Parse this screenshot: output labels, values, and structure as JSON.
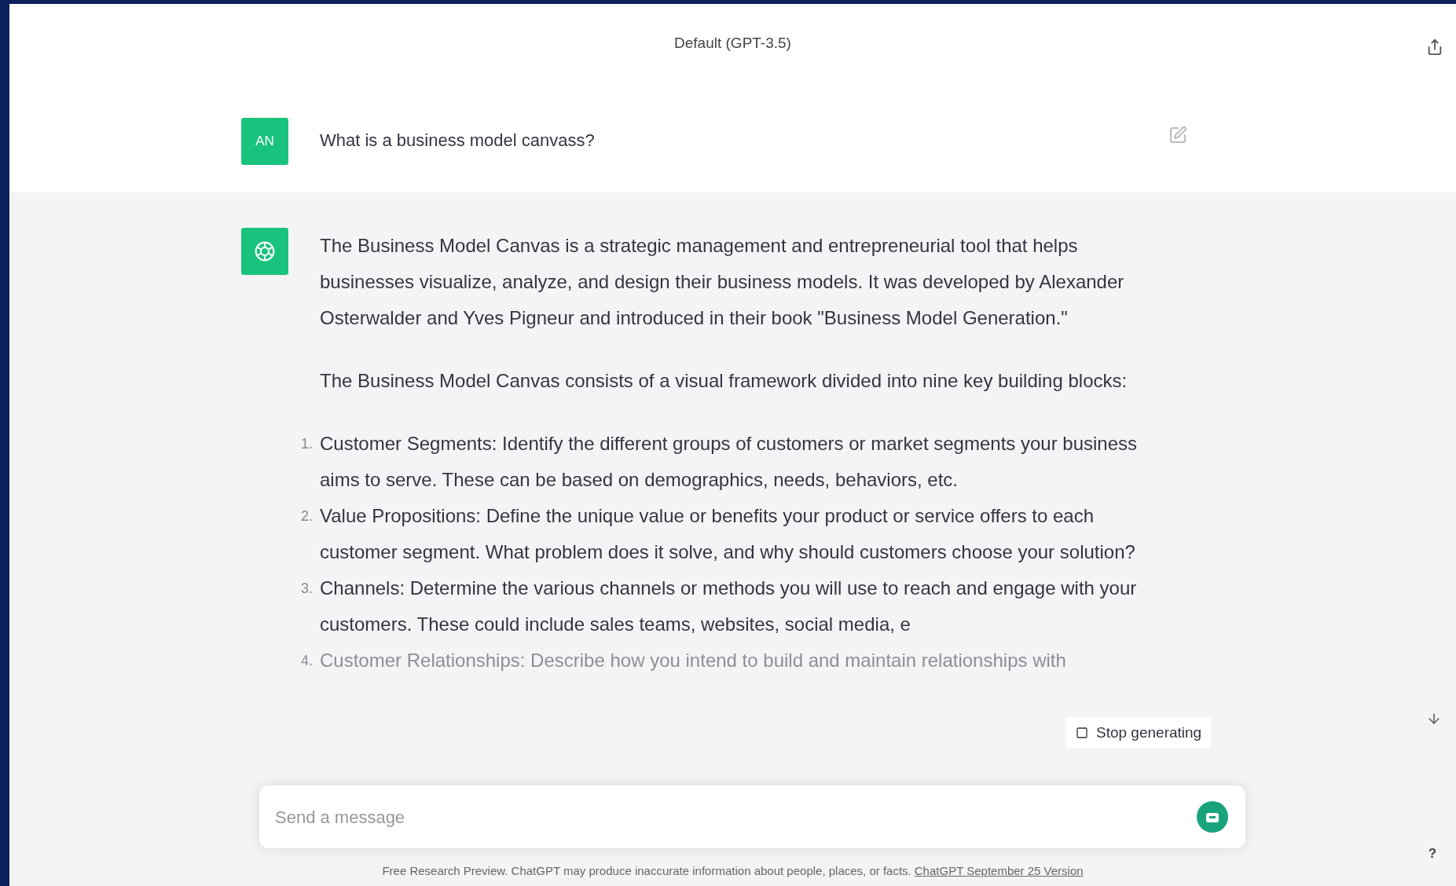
{
  "header": {
    "title": "Default (GPT-3.5)"
  },
  "user_message": {
    "avatar": "AN",
    "text": "What is a business model canvass?"
  },
  "assistant_message": {
    "paragraphs": [
      "The Business Model Canvas is a strategic management and entrepreneurial tool that helps businesses visualize, analyze, and design their business models. It was developed by Alexander Osterwalder and Yves Pigneur and introduced in their book \"Business Model Generation.\"",
      "The Business Model Canvas consists of a visual framework divided into nine key building blocks:"
    ],
    "list": [
      {
        "number": "1.",
        "text": "Customer Segments: Identify the different groups of customers or market segments your business aims to serve. These can be based on demographics, needs, behaviors, etc.",
        "faded": false
      },
      {
        "number": "2.",
        "text": "Value Propositions: Define the unique value or benefits your product or service offers to each customer segment. What problem does it solve, and why should customers choose your solution?",
        "faded": false
      },
      {
        "number": "3.",
        "text": "Channels: Determine the various channels or methods you will use to reach and engage with your customers. These could include sales teams, websites, social media, e",
        "faded": false
      },
      {
        "number": "4.",
        "text": "Customer Relationships: Describe how you intend to build and maintain relationships with",
        "faded": true
      }
    ]
  },
  "stop_button": {
    "label": "Stop generating"
  },
  "composer": {
    "placeholder": "Send a message"
  },
  "footer": {
    "text": "Free Research Preview. ChatGPT may produce inaccurate information about people, places, or facts.",
    "link": "ChatGPT September 25 Version"
  },
  "help_button": {
    "label": "?"
  }
}
